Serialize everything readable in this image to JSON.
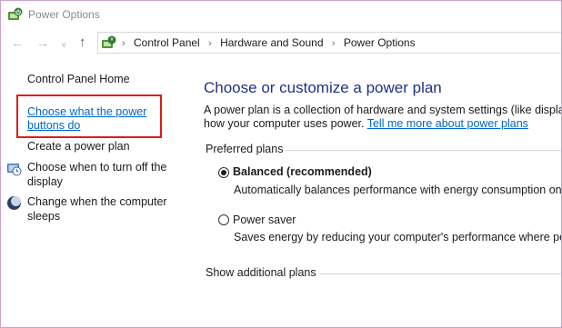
{
  "window": {
    "title": "Power Options",
    "icon": "power-options-icon"
  },
  "nav": {
    "back_icon": "back-arrow-icon",
    "forward_icon": "forward-arrow-icon",
    "recent_icon": "chevron-down-icon",
    "up_icon": "up-arrow-icon",
    "breadcrumbs": [
      "Control Panel",
      "Hardware and Sound",
      "Power Options"
    ]
  },
  "sidebar": {
    "home": "Control Panel Home",
    "choose_buttons_line1": "Choose what the power",
    "choose_buttons_line2": "buttons do",
    "create_plan": "Create a power plan",
    "turn_off_display_line1": "Choose when to turn off the",
    "turn_off_display_line2": "display",
    "sleep_line1": "Change when the computer",
    "sleep_line2": "sleeps"
  },
  "main": {
    "heading": "Choose or customize a power plan",
    "desc_line1": "A power plan is a collection of hardware and system settings (like display b",
    "desc_line2_prefix": "how your computer uses power. ",
    "desc_link": "Tell me more about power plans",
    "preferred_label": "Preferred plans",
    "plans": [
      {
        "name": "Balanced (recommended)",
        "desc": "Automatically balances performance with energy consumption on ca",
        "selected": true
      },
      {
        "name": "Power saver",
        "desc": "Saves energy by reducing your computer's performance where possi",
        "selected": false
      }
    ],
    "additional_label": "Show additional plans"
  },
  "colors": {
    "link": "#0066cc",
    "heading": "#1e3287",
    "highlight": "#e11b1b"
  }
}
